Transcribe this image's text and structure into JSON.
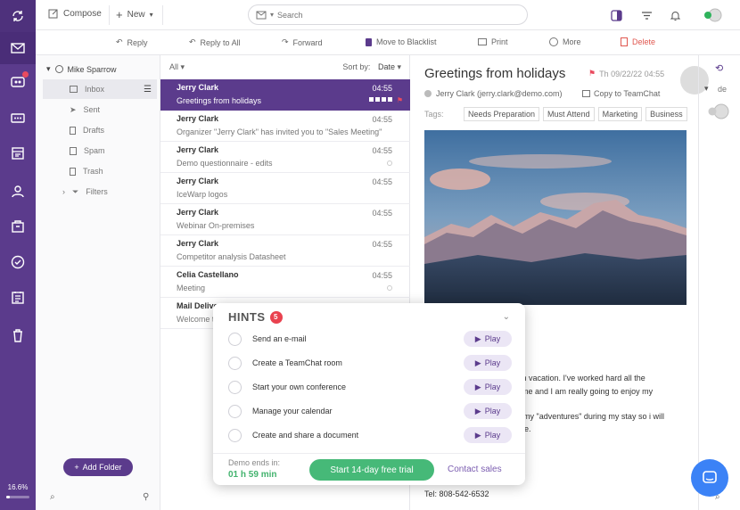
{
  "rail": {
    "items": [
      "sync-icon",
      "mail-icon",
      "chat-icon",
      "conference-icon",
      "calendar-icon",
      "contacts-icon",
      "documents-icon",
      "tasks-icon",
      "notes-icon",
      "trash-icon"
    ],
    "quota_label": "16.6%",
    "quota_fraction": 0.166
  },
  "topbar": {
    "compose": "Compose",
    "new": "New",
    "search_placeholder": "Search"
  },
  "actions": {
    "reply": "Reply",
    "reply_all": "Reply to All",
    "forward": "Forward",
    "blacklist": "Move to Blacklist",
    "print": "Print",
    "more": "More",
    "delete": "Delete"
  },
  "folders": {
    "account": "Mike Sparrow",
    "items": [
      {
        "label": "Inbox"
      },
      {
        "label": "Sent"
      },
      {
        "label": "Drafts"
      },
      {
        "label": "Spam"
      },
      {
        "label": "Trash"
      },
      {
        "label": "Filters"
      }
    ],
    "add_folder": "Add Folder"
  },
  "list": {
    "filter": "All",
    "sort_label": "Sort by:",
    "sort_value": "Date",
    "messages": [
      {
        "from": "Jerry Clark",
        "time": "04:55",
        "subject": "Greetings from holidays"
      },
      {
        "from": "Jerry Clark",
        "time": "04:55",
        "subject": "Organizer \"Jerry Clark\" has invited you to \"Sales Meeting\""
      },
      {
        "from": "Jerry Clark",
        "time": "04:55",
        "subject": "Demo questionnaire - edits"
      },
      {
        "from": "Jerry Clark",
        "time": "04:55",
        "subject": "IceWarp logos"
      },
      {
        "from": "Jerry Clark",
        "time": "04:55",
        "subject": "Webinar On-premises"
      },
      {
        "from": "Jerry Clark",
        "time": "04:55",
        "subject": "Competitor analysis Datasheet"
      },
      {
        "from": "Celia Castellano",
        "time": "04:55",
        "subject": "Meeting"
      },
      {
        "from": "Mail Delive",
        "time": "",
        "subject": "Welcome t"
      }
    ]
  },
  "reader": {
    "subject": "Greetings from holidays",
    "date": "Th 09/22/22 04:55",
    "sender": "Jerry Clark (jerry.clark@demo.com)",
    "copy_to_teamchat": "Copy to TeamChat",
    "tags_label": "Tags:",
    "tags": [
      "Needs Preparation",
      "Must Attend",
      "Marketing",
      "Business"
    ],
    "body_lines": [
      "go on vacation. I've worked hard all the",
      "un time and I am really going to enjoy my",
      "f my \"adventures\" during my stay so i will",
      "e."
    ],
    "phone": "Tel: 808-542-6532"
  },
  "right_strip": {
    "label": "de"
  },
  "hints": {
    "title": "HINTS",
    "count": "5",
    "items": [
      {
        "label": "Send an e-mail",
        "action": "Play"
      },
      {
        "label": "Create a TeamChat room",
        "action": "Play"
      },
      {
        "label": "Start your own conference",
        "action": "Play"
      },
      {
        "label": "Manage your calendar",
        "action": "Play"
      },
      {
        "label": "Create and share a document",
        "action": "Play"
      }
    ],
    "demo_label": "Demo ends in:",
    "demo_time": "01 h 59 min",
    "trial_button": "Start 14-day free trial",
    "contact": "Contact sales"
  },
  "colors": {
    "brand": "#5b3b8c",
    "accent_green": "#46b978",
    "alert_red": "#e9424f",
    "chat_blue": "#3b82f6"
  }
}
